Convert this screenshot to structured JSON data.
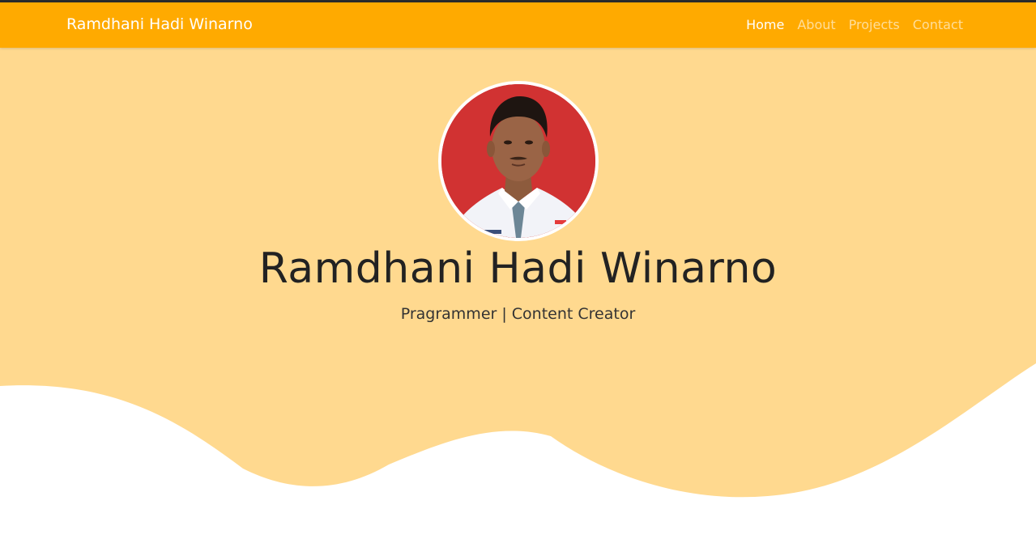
{
  "navbar": {
    "brand": "Ramdhani Hadi Winarno",
    "links": [
      {
        "label": "Home",
        "active": true
      },
      {
        "label": "About",
        "active": false
      },
      {
        "label": "Projects",
        "active": false
      },
      {
        "label": "Contact",
        "active": false
      }
    ]
  },
  "hero": {
    "name": "Ramdhani Hadi Winarno",
    "tagline": "Pragrammer | Content Creator"
  },
  "colors": {
    "navbar": "#ffaa00",
    "hero_background": "#ffd98f",
    "photo_background": "#d13232"
  }
}
